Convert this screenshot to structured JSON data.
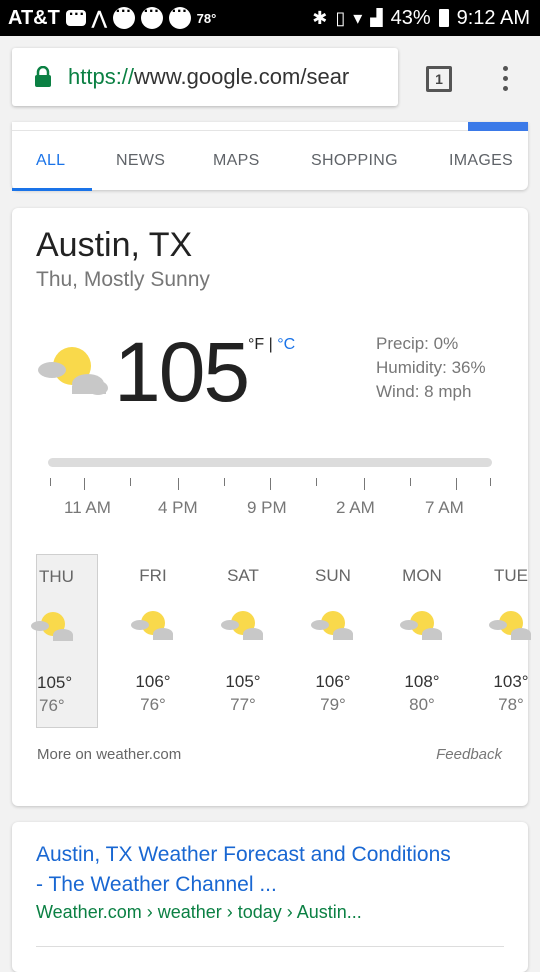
{
  "status_bar": {
    "carrier": "AT&T",
    "temp_small": "78°",
    "battery": "43%",
    "time": "9:12 AM"
  },
  "browser": {
    "url_protocol": "https://",
    "url_rest": "www.google.com/sear",
    "tab_count": "1"
  },
  "tabs": [
    "ALL",
    "NEWS",
    "MAPS",
    "SHOPPING",
    "IMAGES"
  ],
  "weather": {
    "location": "Austin, TX",
    "condition": "Thu, Mostly Sunny",
    "temperature": "105",
    "unit_f": "°F",
    "unit_sep": " | ",
    "unit_c": "°C",
    "precip": "Precip: 0%",
    "humidity": "Humidity: 36%",
    "wind": "Wind: 8 mph",
    "hours": [
      "11 AM",
      "4 PM",
      "9 PM",
      "2 AM",
      "7 AM"
    ],
    "days": [
      {
        "name": "THU",
        "high": "105°",
        "low": "76°"
      },
      {
        "name": "FRI",
        "high": "106°",
        "low": "76°"
      },
      {
        "name": "SAT",
        "high": "105°",
        "low": "77°"
      },
      {
        "name": "SUN",
        "high": "106°",
        "low": "79°"
      },
      {
        "name": "MON",
        "high": "108°",
        "low": "80°"
      },
      {
        "name": "TUE",
        "high": "103°",
        "low": "78°"
      }
    ],
    "more_link": "More on weather.com",
    "feedback": "Feedback"
  },
  "result": {
    "title": "Austin, TX Weather Forecast and Conditions - The Weather Channel ...",
    "url": "Weather.com › weather › today › Austin..."
  },
  "colors": {
    "accent": "#1a73e8",
    "url_green": "#0b8043",
    "sun": "#f9d94b",
    "cloud": "#c8c8c8"
  }
}
